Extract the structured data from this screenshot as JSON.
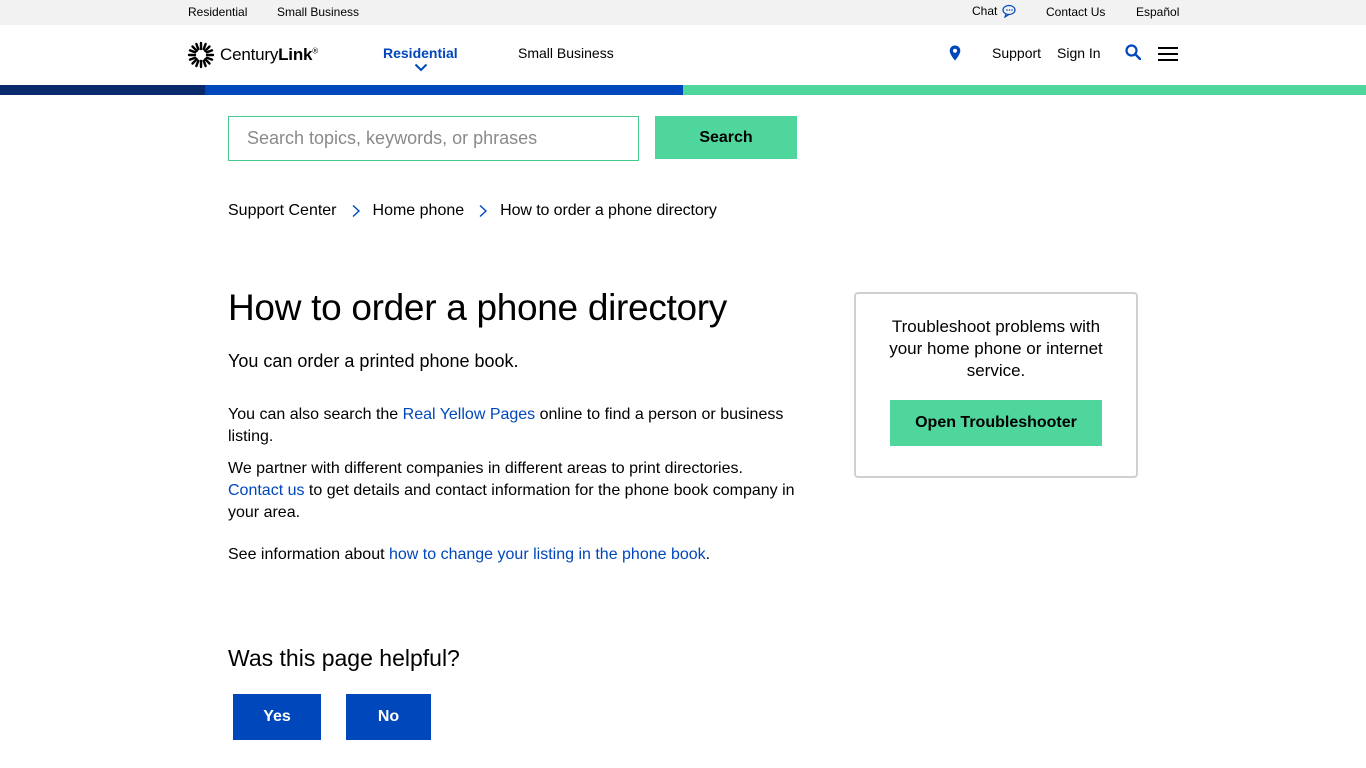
{
  "utility": {
    "residential": "Residential",
    "small_business": "Small Business",
    "chat": "Chat",
    "contact_us": "Contact Us",
    "espanol": "Español"
  },
  "header": {
    "logo_regular": "Century",
    "logo_bold": "Link",
    "logo_tm": "®",
    "nav": [
      {
        "label": "Residential",
        "active": true
      },
      {
        "label": "Small Business",
        "active": false
      }
    ],
    "support": "Support",
    "sign_in": "Sign In"
  },
  "colors": {
    "brand_blue": "#0047bb",
    "navy": "#0a2a6b",
    "green": "#4fd69c"
  },
  "icons": [
    "centurylink-logo-icon",
    "chat-icon",
    "chevron-down-icon",
    "location-pin-icon",
    "search-icon",
    "hamburger-menu-icon",
    "chevron-right-icon"
  ],
  "search": {
    "placeholder": "Search topics, keywords, or phrases",
    "value": "",
    "button_label": "Search"
  },
  "breadcrumb": [
    "Support Center",
    "Home phone",
    "How to order a phone directory"
  ],
  "article": {
    "title": "How to order a phone directory",
    "lead": "You can order a printed phone book.",
    "p1_before": "You can also search the ",
    "p1_link": "Real Yellow Pages",
    "p1_after": " online to find a person or business listing.",
    "p2_line1": "We partner with different companies in different areas to print directories.",
    "p2_link": "Contact us",
    "p2_after": " to get details and contact information for the phone book company in your area.",
    "p3_before": "See information about ",
    "p3_link": "how to change your listing in the phone book",
    "p3_after": "."
  },
  "card": {
    "text": "Troubleshoot problems with your home phone or internet service.",
    "button_label": "Open Troubleshooter"
  },
  "feedback": {
    "question": "Was this page helpful?",
    "yes": "Yes",
    "no": "No"
  }
}
